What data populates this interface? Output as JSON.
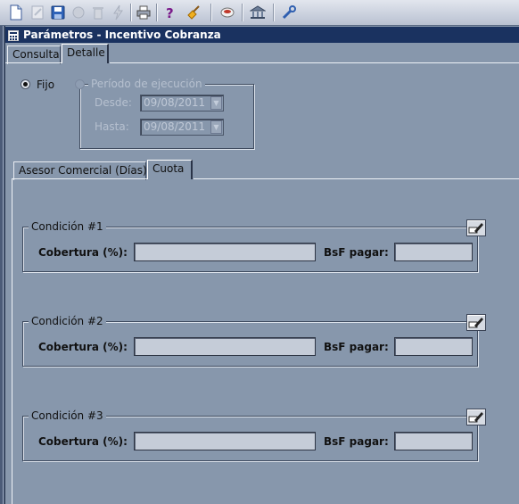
{
  "toolbar": {
    "buttons": [
      {
        "name": "new-icon"
      },
      {
        "name": "edit-icon"
      },
      {
        "name": "save-icon"
      },
      {
        "name": "cancel-icon"
      },
      {
        "name": "delete-icon"
      },
      {
        "name": "run-icon"
      },
      {
        "name": "print-icon"
      },
      {
        "name": "help-icon"
      },
      {
        "name": "clear-icon"
      },
      {
        "name": "cup-icon"
      },
      {
        "name": "bank-icon"
      },
      {
        "name": "tools-icon"
      }
    ]
  },
  "window": {
    "title": "Parámetros - Incentivo Cobranza"
  },
  "tabs": {
    "consulta": "Consulta",
    "detalle": "Detalle"
  },
  "mode": {
    "fijo_label": "Fijo",
    "fijo_selected": true,
    "period_label": "Período de ejecución",
    "desde_label": "Desde:",
    "desde_value": "09/08/2011",
    "hasta_label": "Hasta:",
    "hasta_value": "09/08/2011"
  },
  "subtabs": {
    "asesor": "Asesor Comercial (Días)",
    "cuota": "Cuota"
  },
  "conditions": [
    {
      "title": "Condición #1",
      "cobertura_label": "Cobertura (%):",
      "cobertura_value": "",
      "bsf_label": "BsF pagar:",
      "bsf_value": ""
    },
    {
      "title": "Condición #2",
      "cobertura_label": "Cobertura (%):",
      "cobertura_value": "",
      "bsf_label": "BsF pagar:",
      "bsf_value": ""
    },
    {
      "title": "Condición #3",
      "cobertura_label": "Cobertura (%):",
      "cobertura_value": "",
      "bsf_label": "BsF pagar:",
      "bsf_value": ""
    }
  ],
  "colors": {
    "background": "#8797ac",
    "titlebar": "#1a3260",
    "field": "#c5ccd8"
  }
}
